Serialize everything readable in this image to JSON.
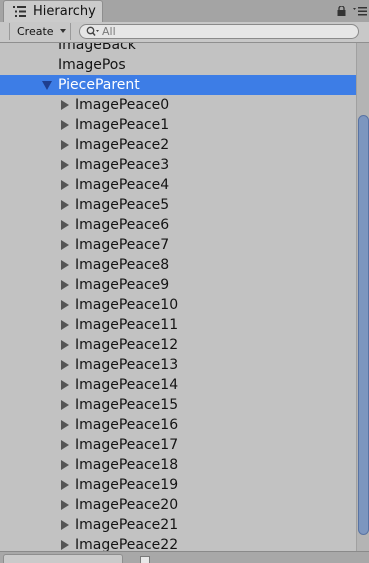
{
  "window": {
    "tab_title": "Hierarchy",
    "tab_icon": "hierarchy-list-icon",
    "lock_icon": "lock-icon",
    "menu_icon": "panel-menu-icon"
  },
  "toolbar": {
    "create_label": "Create",
    "search_placeholder": "All",
    "search_value": ""
  },
  "tree": {
    "items": [
      {
        "label": "ImageBack",
        "foldout": "none",
        "selected": false
      },
      {
        "label": "ImagePos",
        "foldout": "none",
        "selected": false
      },
      {
        "label": "PieceParent",
        "foldout": "expanded",
        "selected": true
      },
      {
        "label": "ImagePeace0",
        "foldout": "collapsed",
        "selected": false
      },
      {
        "label": "ImagePeace1",
        "foldout": "collapsed",
        "selected": false
      },
      {
        "label": "ImagePeace2",
        "foldout": "collapsed",
        "selected": false
      },
      {
        "label": "ImagePeace3",
        "foldout": "collapsed",
        "selected": false
      },
      {
        "label": "ImagePeace4",
        "foldout": "collapsed",
        "selected": false
      },
      {
        "label": "ImagePeace5",
        "foldout": "collapsed",
        "selected": false
      },
      {
        "label": "ImagePeace6",
        "foldout": "collapsed",
        "selected": false
      },
      {
        "label": "ImagePeace7",
        "foldout": "collapsed",
        "selected": false
      },
      {
        "label": "ImagePeace8",
        "foldout": "collapsed",
        "selected": false
      },
      {
        "label": "ImagePeace9",
        "foldout": "collapsed",
        "selected": false
      },
      {
        "label": "ImagePeace10",
        "foldout": "collapsed",
        "selected": false
      },
      {
        "label": "ImagePeace11",
        "foldout": "collapsed",
        "selected": false
      },
      {
        "label": "ImagePeace12",
        "foldout": "collapsed",
        "selected": false
      },
      {
        "label": "ImagePeace13",
        "foldout": "collapsed",
        "selected": false
      },
      {
        "label": "ImagePeace14",
        "foldout": "collapsed",
        "selected": false
      },
      {
        "label": "ImagePeace15",
        "foldout": "collapsed",
        "selected": false
      },
      {
        "label": "ImagePeace16",
        "foldout": "collapsed",
        "selected": false
      },
      {
        "label": "ImagePeace17",
        "foldout": "collapsed",
        "selected": false
      },
      {
        "label": "ImagePeace18",
        "foldout": "collapsed",
        "selected": false
      },
      {
        "label": "ImagePeace19",
        "foldout": "collapsed",
        "selected": false
      },
      {
        "label": "ImagePeace20",
        "foldout": "collapsed",
        "selected": false
      },
      {
        "label": "ImagePeace21",
        "foldout": "collapsed",
        "selected": false
      },
      {
        "label": "ImagePeace22",
        "foldout": "collapsed",
        "selected": false
      }
    ]
  },
  "colors": {
    "selection": "#3d7de6",
    "panel_background": "#c2c2c2",
    "scroll_thumb": "#7d96bf"
  }
}
